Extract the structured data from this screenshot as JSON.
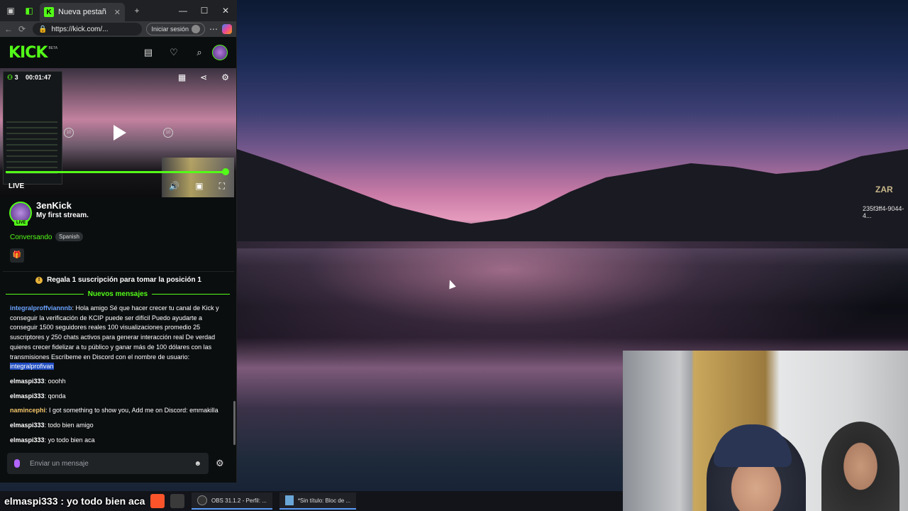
{
  "browser": {
    "tab_title": "Nueva pestañ",
    "url": "https://kick.com/...",
    "signin_label": "Iniciar sesión"
  },
  "kick": {
    "logo": "KICK",
    "beta": "BETA"
  },
  "player": {
    "viewers": "3",
    "timer": "00:01:47",
    "skip_back": "10",
    "skip_forward": "10",
    "live_label": "LIVE"
  },
  "channel": {
    "name": "3enKick",
    "stream_title": "My first stream.",
    "live_badge": "LIVE",
    "category": "Conversando",
    "language": "Spanish"
  },
  "gift_banner": "Regala 1 suscripción para tomar la posición 1",
  "new_messages_label": "Nuevos mensajes",
  "chat": {
    "messages": [
      {
        "user": "integralproffviannnb",
        "text": "Hola amigo Sé que hacer crecer tu canal de Kick y conseguir la verificación de KCIP puede ser difícil Puedo ayudarte a conseguir 1500 seguidores reales 100 visualizaciones promedio 25 suscriptores y 250 chats activos para generar interacción real De verdad quieres crecer fidelizar a tu público y ganar más de 100 dólares con las transmisiones Escríbeme en Discord con el nombre de usuario:",
        "highlight": "integralprofivan"
      },
      {
        "user": "elmaspi333",
        "text": "ooohh"
      },
      {
        "user": "elmaspi333",
        "text": "qonda"
      },
      {
        "user": "namincephi",
        "text": "I got something to show you, Add me on Discord: emmakilla"
      },
      {
        "user": "elmaspi333",
        "text": "todo bien amigo"
      },
      {
        "user": "elmaspi333",
        "text": "yo todo bien aca"
      }
    ],
    "input_placeholder": "Enviar un mensaje"
  },
  "desktop": {
    "zar_logo": "ZAR",
    "uuid": "235f3ff4-9044-4..."
  },
  "taskbar": {
    "overlay_text": "elmaspi333 : yo todo bien aca",
    "items": [
      {
        "label": "OBS 31.1.2 - Perfil: ..."
      },
      {
        "label": "*Sin título: Bloc de ..."
      }
    ]
  }
}
